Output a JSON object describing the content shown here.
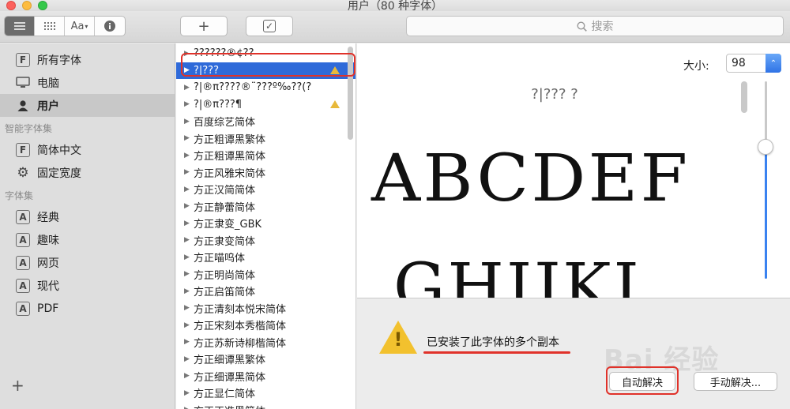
{
  "window": {
    "title": "用户（80 种字体）"
  },
  "toolbar": {
    "view_aa_label": "Aa",
    "add_symbol": "+",
    "validate_symbol": "✓",
    "search_placeholder": "搜索"
  },
  "sidebar": {
    "top_items": [
      {
        "label": "所有字体",
        "icon": "font-collection-icon"
      },
      {
        "label": "电脑",
        "icon": "computer-icon"
      },
      {
        "label": "用户",
        "icon": "user-icon",
        "selected": true
      }
    ],
    "smart_header": "智能字体集",
    "smart_items": [
      {
        "label": "简体中文",
        "icon": "font-collection-icon"
      },
      {
        "label": "固定宽度",
        "icon": "gear-icon"
      }
    ],
    "collections_header": "字体集",
    "collection_items": [
      {
        "label": "经典"
      },
      {
        "label": "趣味"
      },
      {
        "label": "网页"
      },
      {
        "label": "现代"
      },
      {
        "label": "PDF"
      }
    ],
    "add_symbol": "+"
  },
  "font_list": [
    {
      "name": "??????®¢??"
    },
    {
      "name": "?|???",
      "selected": true,
      "warning": true
    },
    {
      "name": "?|®π????®¨???º‰??(?"
    },
    {
      "name": "?|®π???¶",
      "warning": true
    },
    {
      "name": "百度综艺简体"
    },
    {
      "name": "方正粗谭黑繁体"
    },
    {
      "name": "方正粗谭黑简体"
    },
    {
      "name": "方正风雅宋简体"
    },
    {
      "name": "方正汉简简体"
    },
    {
      "name": "方正静蕾简体"
    },
    {
      "name": "方正隶变_GBK"
    },
    {
      "name": "方正隶变简体"
    },
    {
      "name": "方正喵呜体"
    },
    {
      "name": "方正明尚简体"
    },
    {
      "name": "方正启笛简体"
    },
    {
      "name": "方正清刻本悦宋简体"
    },
    {
      "name": "方正宋刻本秀楷简体"
    },
    {
      "name": "方正苏新诗柳楷简体"
    },
    {
      "name": "方正细谭黑繁体"
    },
    {
      "name": "方正细谭黑简体"
    },
    {
      "name": "方正显仁简体"
    },
    {
      "name": "方正正准黑简体"
    }
  ],
  "preview": {
    "size_label": "大小:",
    "size_value": "98",
    "font_name": "?|??? ?",
    "sample_line_1": "ABCDEF",
    "sample_line_2": "GHIJKL",
    "size_slider_fraction": 0.33
  },
  "info": {
    "message": "已安装了此字体的多个副本",
    "auto_resolve": "自动解决",
    "manual_resolve": "手动解决..."
  },
  "watermark": "Bai 经验",
  "colors": {
    "selection_blue": "#2f6ad9",
    "annotation_red": "#e0322a",
    "warning_yellow": "#f2c12e"
  }
}
